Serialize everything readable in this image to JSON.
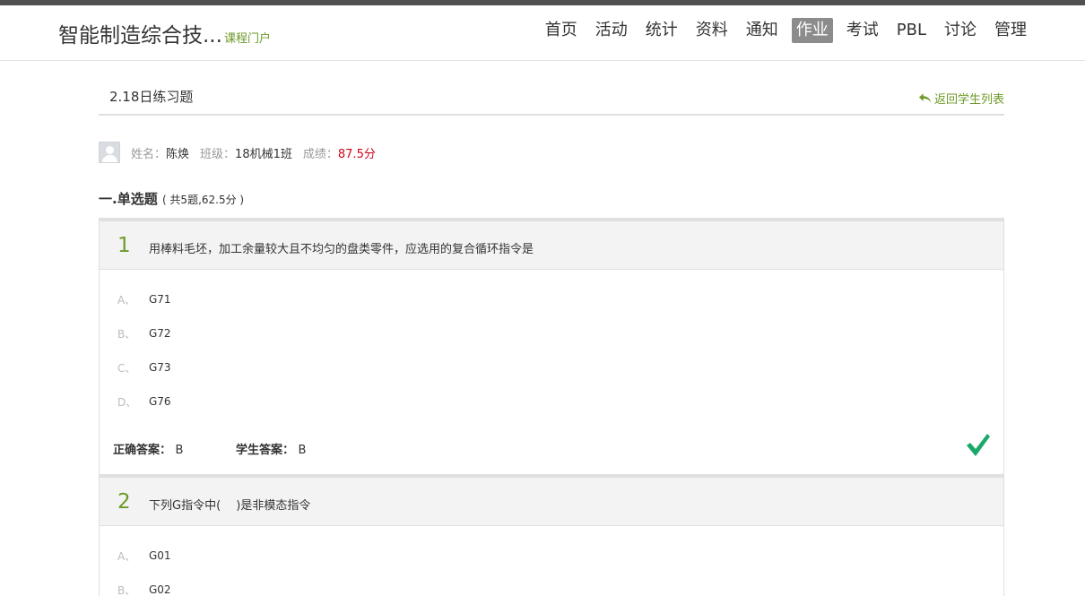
{
  "header": {
    "course_title": "智能制造综合技...",
    "portal_link": "课程门户",
    "nav": [
      {
        "label": "首页",
        "active": false
      },
      {
        "label": "活动",
        "active": false
      },
      {
        "label": "统计",
        "active": false
      },
      {
        "label": "资料",
        "active": false
      },
      {
        "label": "通知",
        "active": false
      },
      {
        "label": "作业",
        "active": true
      },
      {
        "label": "考试",
        "active": false
      },
      {
        "label": "PBL",
        "active": false
      },
      {
        "label": "讨论",
        "active": false
      },
      {
        "label": "管理",
        "active": false
      }
    ]
  },
  "assignment": {
    "title": "2.18日练习题",
    "back_label": "返回学生列表"
  },
  "student": {
    "name_label": "姓名：",
    "name": "陈焕",
    "class_label": "班级：",
    "class": "18机械1班",
    "score_label": "成绩：",
    "score": "87.5分"
  },
  "section": {
    "title": "一.单选题",
    "meta": "( 共5题,62.5分 )"
  },
  "questions": [
    {
      "num": "1",
      "text": "用棒料毛坯，加工余量较大且不均匀的盘类零件，应选用的复合循环指令是",
      "options": [
        {
          "letter": "A、",
          "text": "G71"
        },
        {
          "letter": "B、",
          "text": "G72"
        },
        {
          "letter": "C、",
          "text": "G73"
        },
        {
          "letter": "D、",
          "text": "G76"
        }
      ],
      "correct_label": "正确答案：",
      "correct": "B",
      "student_label": "学生答案：",
      "student_answer": "B"
    },
    {
      "num": "2",
      "text": "下列G指令中(　 )是非模态指令",
      "options": [
        {
          "letter": "A、",
          "text": "G01"
        },
        {
          "letter": "B、",
          "text": "G02"
        }
      ]
    }
  ],
  "colors": {
    "accent_green": "#6d9a28",
    "score_red": "#d0021b",
    "check_green": "#1aa86b",
    "nav_active_bg": "#8c8c8c"
  }
}
